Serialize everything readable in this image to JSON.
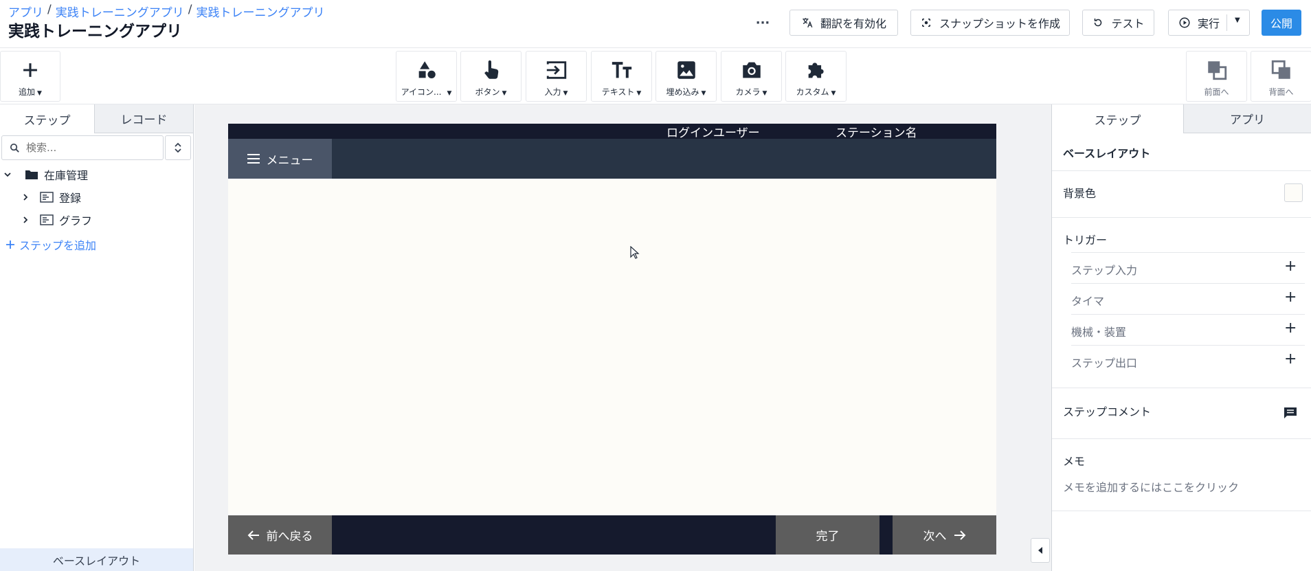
{
  "breadcrumb": {
    "items": [
      "アプリ",
      "実践トレーニングアプリ",
      "実践トレーニングアプリ"
    ],
    "separator": "/"
  },
  "header": {
    "title": "実践トレーニングアプリ",
    "more_label": "···",
    "translate_label": "翻訳を有効化",
    "snapshot_label": "スナップショットを作成",
    "test_label": "テスト",
    "run_label": "実行",
    "publish_label": "公開"
  },
  "toolbar": {
    "add_label": "追加",
    "tools": [
      {
        "name": "icon",
        "label": "アイコン..."
      },
      {
        "name": "button",
        "label": "ボタン"
      },
      {
        "name": "input",
        "label": "入力"
      },
      {
        "name": "text",
        "label": "テキスト"
      },
      {
        "name": "embed",
        "label": "埋め込み"
      },
      {
        "name": "camera",
        "label": "カメラ"
      },
      {
        "name": "custom",
        "label": "カスタム"
      }
    ],
    "front_label": "前面へ",
    "back_label": "背面へ"
  },
  "left_panel": {
    "tabs": [
      "ステップ",
      "レコード"
    ],
    "search_placeholder": "検索...",
    "tree": {
      "folder": "在庫管理",
      "children": [
        "登録",
        "グラフ"
      ]
    },
    "add_step_label": "ステップを追加",
    "base_layout_label": "ベースレイアウト"
  },
  "canvas": {
    "login_user": "ログインユーザー",
    "station_name": "ステーション名",
    "menu_label": "メニュー",
    "back_label": "前へ戻る",
    "complete_label": "完了",
    "next_label": "次へ"
  },
  "right_panel": {
    "tabs": [
      "ステップ",
      "アプリ"
    ],
    "section_title": "ベースレイアウト",
    "bg_color_label": "背景色",
    "bg_color_value": "#fdfcf8",
    "trigger_label": "トリガー",
    "triggers": [
      "ステップ入力",
      "タイマ",
      "機械・装置",
      "ステップ出口"
    ],
    "step_comment_label": "ステップコメント",
    "memo_label": "メモ",
    "memo_placeholder": "メモを追加するにはここをクリック"
  },
  "colors": {
    "accent": "#2b8be6",
    "screen_dark": "#151a2d",
    "menu_bar": "#283445"
  }
}
